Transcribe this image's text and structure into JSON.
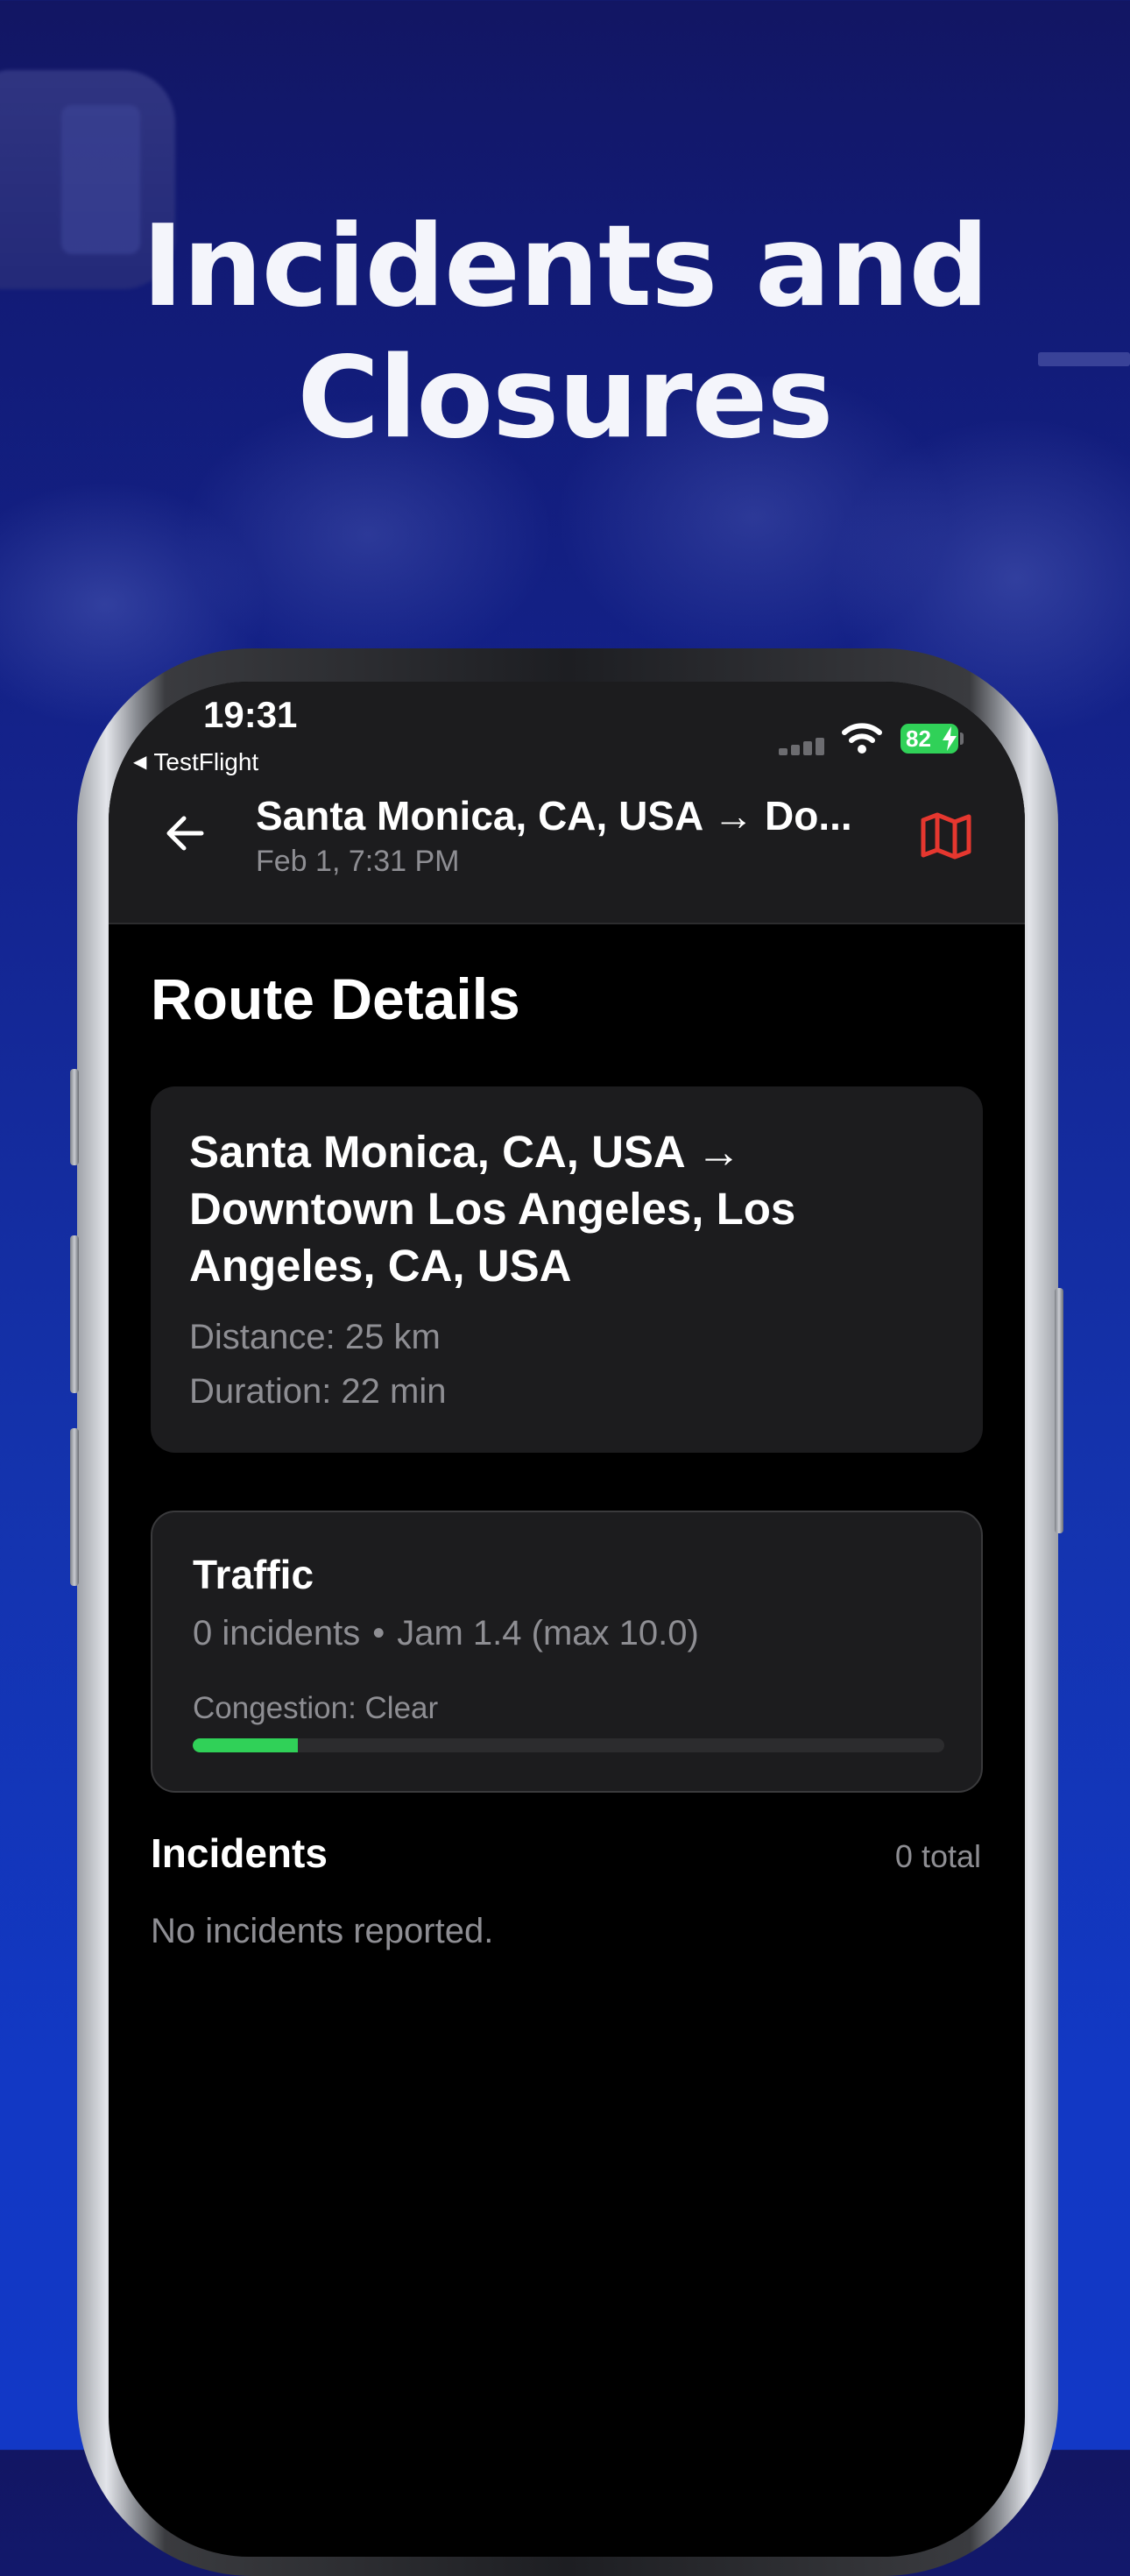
{
  "promo": {
    "headline_line1": "Incidents and",
    "headline_line2": "Closures"
  },
  "status_bar": {
    "time": "19:31",
    "back_app": "TestFlight",
    "battery": "82"
  },
  "nav": {
    "title": "Santa Monica, CA, USA → Do...",
    "subtitle": "Feb 1, 7:31 PM",
    "back_icon": "arrow-left-icon",
    "map_icon": "map-icon",
    "map_icon_color": "#e5372f"
  },
  "page": {
    "title": "Route Details"
  },
  "route": {
    "name": "Santa Monica, CA, USA → Downtown Los Angeles, Los Angeles, CA, USA",
    "distance": "Distance: 25 km",
    "duration": "Duration: 22 min"
  },
  "traffic": {
    "title": "Traffic",
    "incidents_count": "0 incidents",
    "separator": "•",
    "jam": "Jam 1.4 (max 10.0)",
    "congestion": "Congestion: Clear",
    "congestion_level": 0.14,
    "congestion_color": "#30d158"
  },
  "incidents": {
    "heading": "Incidents",
    "total": "0 total",
    "empty_message": "No incidents reported."
  }
}
